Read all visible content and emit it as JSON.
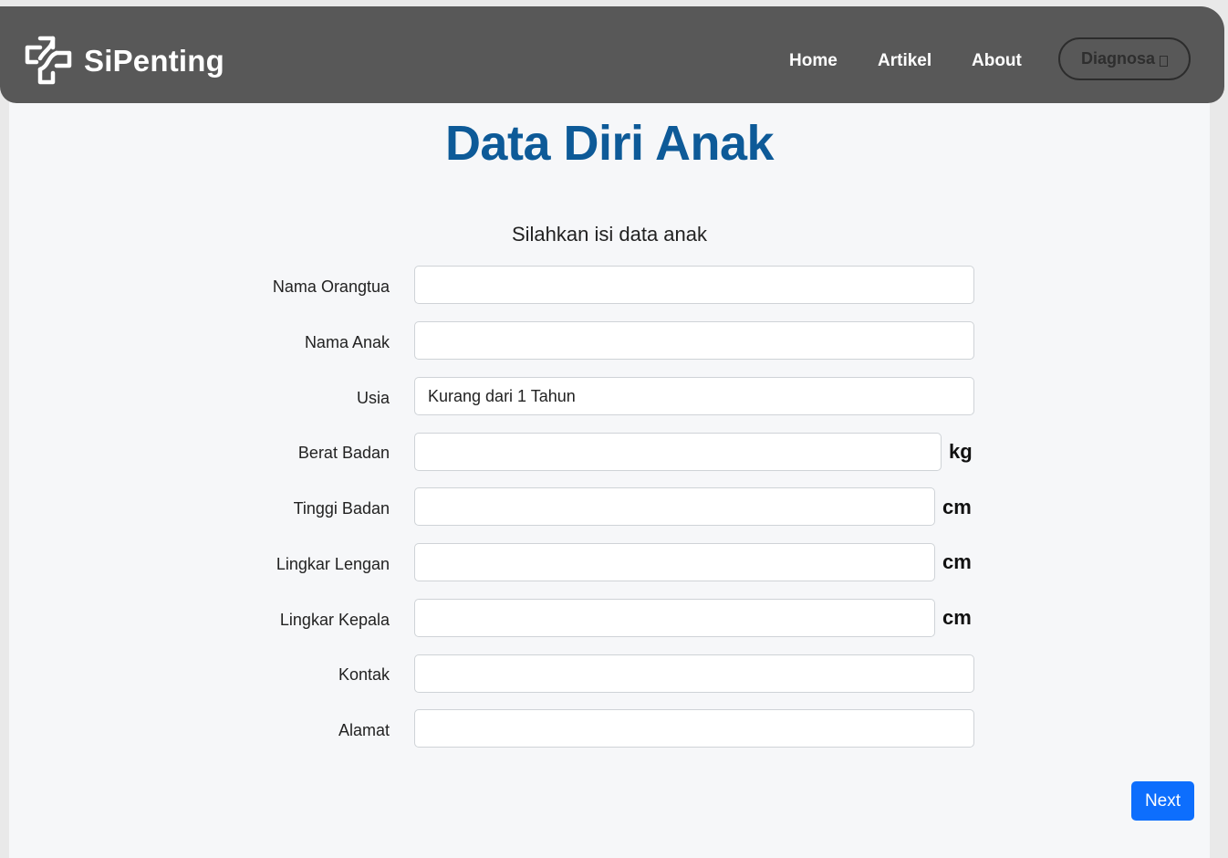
{
  "navbar": {
    "brand": "SiPenting",
    "logo_icon": "medical-cross-logo-icon",
    "links": [
      "Home",
      "Artikel",
      "About"
    ],
    "cta_label": "Diagnosa",
    "cta_icon": "missing-glyph-box-icon",
    "bg_color": "#585858"
  },
  "page": {
    "title": "Data Diri Anak",
    "subtitle": "Silahkan isi data anak",
    "title_color": "#0d5a98"
  },
  "form": {
    "fields": [
      {
        "label": "Nama Orangtua",
        "value": "",
        "unit": ""
      },
      {
        "label": "Nama Anak",
        "value": "",
        "unit": ""
      },
      {
        "label": "Usia",
        "value": "Kurang dari 1 Tahun",
        "unit": ""
      },
      {
        "label": "Berat Badan",
        "value": "",
        "unit": "kg"
      },
      {
        "label": "Tinggi Badan",
        "value": "",
        "unit": "cm"
      },
      {
        "label": "Lingkar Lengan",
        "value": "",
        "unit": "cm"
      },
      {
        "label": "Lingkar Kepala",
        "value": "",
        "unit": "cm"
      },
      {
        "label": "Kontak",
        "value": "",
        "unit": ""
      },
      {
        "label": "Alamat",
        "value": "",
        "unit": ""
      }
    ],
    "next_label": "Next",
    "button_color": "#0d6efd"
  }
}
